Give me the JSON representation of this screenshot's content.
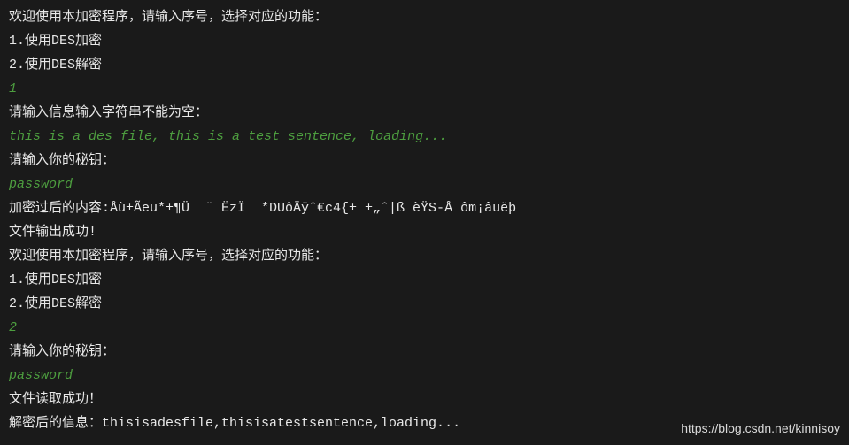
{
  "terminal": {
    "lines": [
      {
        "text": "欢迎使用本加密程序，请输入序号，选择对应的功能：",
        "cls": "terminal-line"
      },
      {
        "text": "1.使用DES加密",
        "cls": "terminal-line"
      },
      {
        "text": "2.使用DES解密",
        "cls": "terminal-line"
      },
      {
        "text": "1",
        "cls": "input-line"
      },
      {
        "text": "请输入信息输入字符串不能为空：",
        "cls": "terminal-line"
      },
      {
        "text": "this is a des file, this is a test sentence, loading...",
        "cls": "input-line"
      },
      {
        "text": "请输入你的秘钥：",
        "cls": "terminal-line"
      },
      {
        "text": "password",
        "cls": "input-line"
      },
      {
        "text": "加密过后的内容:Åù±Ãeu*±¶Ü  ¨ ËzÏ  *DUôÄÿˆ€c4{± ±„ˆ|ß èŸS-Å ôm¡âuëþ",
        "cls": "terminal-line"
      },
      {
        "text": "文件输出成功!",
        "cls": "terminal-line"
      },
      {
        "text": "欢迎使用本加密程序，请输入序号，选择对应的功能：",
        "cls": "terminal-line"
      },
      {
        "text": "1.使用DES加密",
        "cls": "terminal-line"
      },
      {
        "text": "2.使用DES解密",
        "cls": "terminal-line"
      },
      {
        "text": "2",
        "cls": "input-line"
      },
      {
        "text": "请输入你的秘钥：",
        "cls": "terminal-line"
      },
      {
        "text": "password",
        "cls": "input-line"
      },
      {
        "text": "文件读取成功！",
        "cls": "terminal-line"
      },
      {
        "text": "解密后的信息：thisisadesfile,thisisatestsentence,loading...",
        "cls": "terminal-line"
      }
    ]
  },
  "watermark": {
    "text": "https://blog.csdn.net/kinnisoy"
  }
}
